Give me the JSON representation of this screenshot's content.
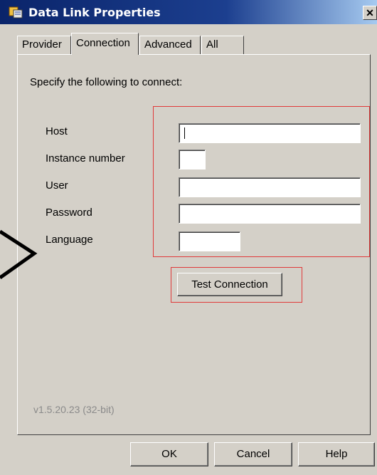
{
  "window": {
    "title": "Data Link Properties",
    "close_glyph": "✕"
  },
  "tabs": [
    {
      "label": "Provider"
    },
    {
      "label": "Connection",
      "active": true
    },
    {
      "label": "Advanced"
    },
    {
      "label": "All"
    }
  ],
  "connection": {
    "instruction": "Specify the following to connect:",
    "fields": {
      "host": {
        "label": "Host",
        "value": ""
      },
      "instance": {
        "label": "Instance number",
        "value": ""
      },
      "user": {
        "label": "User",
        "value": ""
      },
      "password": {
        "label": "Password",
        "value": ""
      },
      "language": {
        "label": "Language",
        "value": ""
      }
    },
    "test_button": "Test Connection",
    "version": "v1.5.20.23 (32-bit)"
  },
  "footer": {
    "ok": "OK",
    "cancel": "Cancel",
    "help": "Help"
  },
  "colors": {
    "highlight": "#e03a3a",
    "dialog_bg": "#d4d0c8",
    "title_bg": "#0a246a"
  }
}
